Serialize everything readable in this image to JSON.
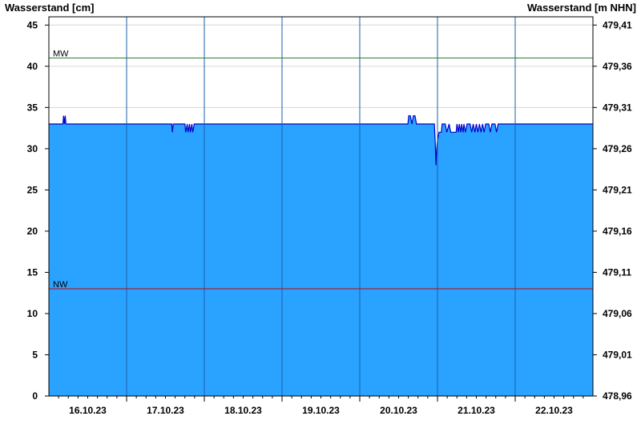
{
  "chart_data": {
    "type": "area",
    "y_left_label": "Wasserstand [cm]",
    "y_right_label": "Wasserstand [m NHN]",
    "ylim": [
      0,
      46
    ],
    "y_ticks": [
      0,
      5,
      10,
      15,
      20,
      25,
      30,
      35,
      40,
      45
    ],
    "y_right_ticks": [
      "478,96",
      "479,01",
      "479,06",
      "479,11",
      "479,16",
      "479,21",
      "479,26",
      "479,31",
      "479,36",
      "479,41"
    ],
    "xlim": [
      0,
      7
    ],
    "x_tick_labels": [
      "16.10.23",
      "17.10.23",
      "18.10.23",
      "19.10.23",
      "20.10.23",
      "21.10.23",
      "22.10.23"
    ],
    "day_boundaries": [
      1,
      2,
      3,
      4,
      5,
      6
    ],
    "reference_lines": [
      {
        "label": "MW",
        "value": 41,
        "color": "#2e7d32"
      },
      {
        "label": "NW",
        "value": 13,
        "color": "#cc0000"
      }
    ],
    "series": [
      {
        "color_fill": "#29a3ff",
        "color_line": "#0000cc",
        "x": [
          0,
          0.18,
          0.19,
          0.2,
          0.21,
          0.22,
          1.58,
          1.59,
          1.6,
          1.61,
          1.75,
          1.76,
          1.78,
          1.79,
          1.81,
          1.82,
          1.84,
          1.85,
          1.87,
          1.88,
          4.62,
          4.63,
          4.65,
          4.67,
          4.69,
          4.71,
          4.73,
          4.74,
          4.75,
          4.76,
          4.96,
          4.97,
          4.98,
          4.99,
          5.0,
          5.02,
          5.05,
          5.06,
          5.1,
          5.12,
          5.15,
          5.17,
          5.18,
          5.2,
          5.24,
          5.25,
          5.27,
          5.28,
          5.3,
          5.31,
          5.33,
          5.34,
          5.36,
          5.38,
          5.4,
          5.42,
          5.44,
          5.46,
          5.48,
          5.5,
          5.52,
          5.54,
          5.56,
          5.58,
          5.6,
          5.62,
          5.64,
          5.66,
          5.68,
          5.7,
          5.72,
          5.74,
          5.76,
          5.78,
          5.8,
          5.82,
          5.84,
          5.86,
          5.88,
          5.9,
          7.0
        ],
        "values": [
          33,
          33,
          34,
          33,
          34,
          33,
          33,
          32,
          33,
          33,
          33,
          32,
          33,
          32,
          33,
          32,
          33,
          32,
          33,
          33,
          33,
          34,
          34,
          33,
          34,
          34,
          33,
          33,
          33,
          33,
          33,
          31,
          28,
          30,
          31,
          32,
          32,
          33,
          33,
          32,
          33,
          32,
          32,
          32,
          32,
          33,
          32,
          33,
          32,
          33,
          32,
          33,
          32,
          33,
          33,
          33,
          32,
          33,
          32,
          33,
          32,
          33,
          32,
          33,
          32,
          33,
          33,
          33,
          32,
          33,
          33,
          33,
          32,
          33,
          33,
          33,
          33,
          33,
          33,
          33,
          33
        ]
      }
    ]
  }
}
